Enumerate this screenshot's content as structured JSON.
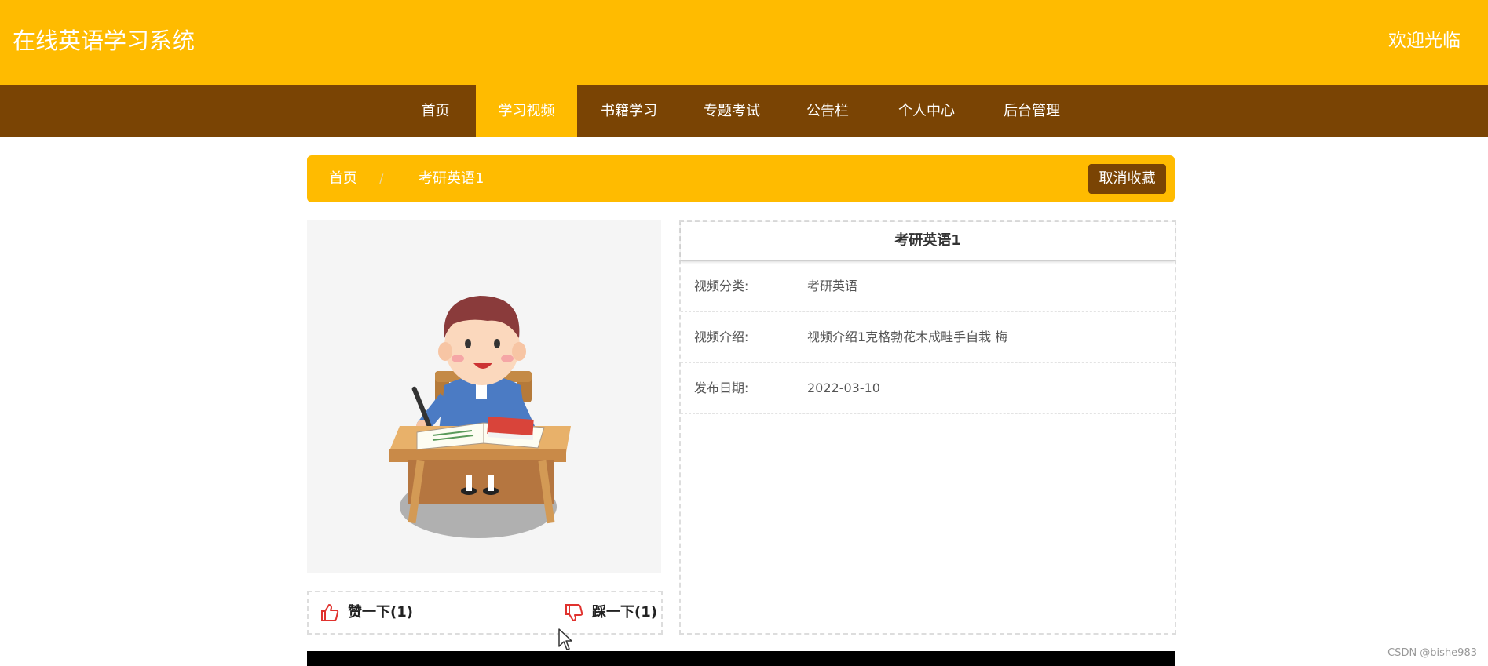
{
  "header": {
    "site_title": "在线英语学习系统",
    "welcome": "欢迎光临",
    "bg_color": "#FFBB00"
  },
  "nav": {
    "bg_color": "#7A4404",
    "items": [
      {
        "label": "首页",
        "active": false
      },
      {
        "label": "学习视频",
        "active": true
      },
      {
        "label": "书籍学习",
        "active": false
      },
      {
        "label": "专题考试",
        "active": false
      },
      {
        "label": "公告栏",
        "active": false
      },
      {
        "label": "个人中心",
        "active": false
      },
      {
        "label": "后台管理",
        "active": false
      }
    ]
  },
  "breadcrumb": {
    "home": "首页",
    "separator": "/",
    "current": "考研英语1"
  },
  "uncollect_button": "取消收藏",
  "vote": {
    "like_label": "赞一下(1)",
    "dislike_label": "踩一下(1)"
  },
  "detail": {
    "title": "考研英语1",
    "rows": [
      {
        "label": "视频分类:",
        "value": "考研英语"
      },
      {
        "label": "视频介绍:",
        "value": "视频介绍1克格勃花木成畦手自栽 梅"
      },
      {
        "label": "发布日期:",
        "value": "2022-03-10"
      }
    ]
  },
  "watermark": "CSDN @bishe983"
}
